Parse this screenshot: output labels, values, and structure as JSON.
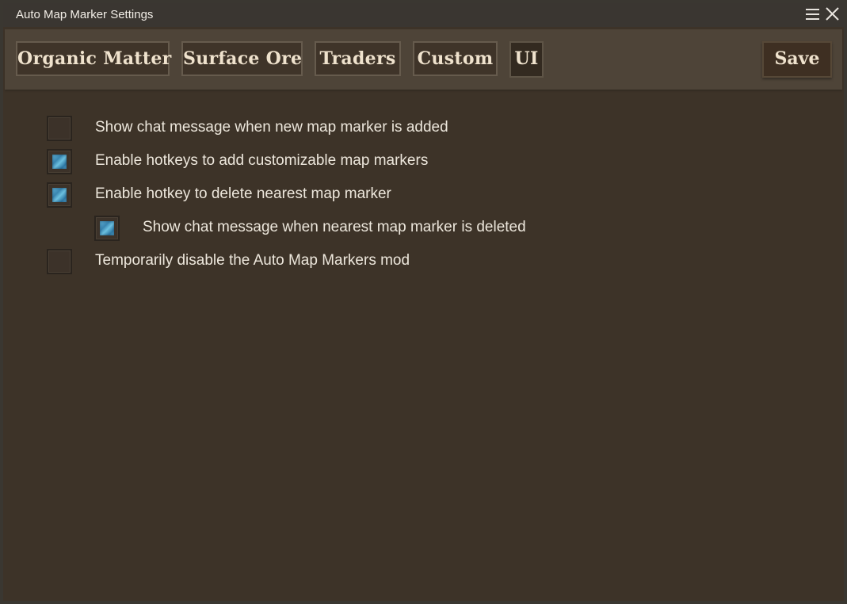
{
  "window": {
    "title": "Auto Map Marker Settings"
  },
  "titlebar": {
    "menu_icon": "hamburger-menu-icon",
    "close_icon": "close-icon"
  },
  "tabs": [
    {
      "label": "Organic Matter",
      "active": false
    },
    {
      "label": "Surface Ore",
      "active": false
    },
    {
      "label": "Traders",
      "active": false
    },
    {
      "label": "Custom",
      "active": false
    },
    {
      "label": "UI",
      "active": true
    }
  ],
  "save_label": "Save",
  "options": [
    {
      "label": "Show chat message when new map marker is added",
      "checked": false
    },
    {
      "label": "Enable hotkeys to add customizable map markers",
      "checked": true
    },
    {
      "label": "Enable hotkey to delete nearest map marker",
      "checked": true
    },
    {
      "label": "Show chat message when nearest map marker is deleted",
      "checked": true
    },
    {
      "label": "Temporarily disable the Auto Map Markers mod",
      "checked": false
    }
  ],
  "colors": {
    "panel_bg": "#3d3328",
    "toolbar_bg": "#4e4438",
    "check_fill": "#3a86b0"
  }
}
